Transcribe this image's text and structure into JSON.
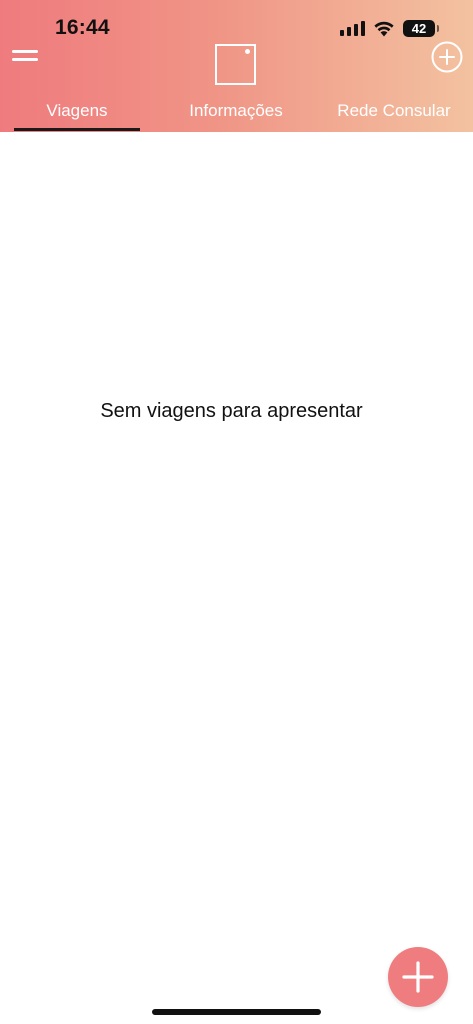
{
  "status_bar": {
    "time": "16:44",
    "battery_level": "42",
    "icons": [
      "signal-icon",
      "wifi-icon",
      "battery-icon"
    ]
  },
  "header": {
    "menu_icon": "menu-icon",
    "logo_icon": "app-logo-icon",
    "add_icon": "add-circle-icon",
    "gradient_start": "#ef7b7e",
    "gradient_end": "#f3c2a0"
  },
  "tabs": [
    {
      "label": "Viagens",
      "active": true
    },
    {
      "label": "Informações",
      "active": false
    },
    {
      "label": "Rede Consular",
      "active": false
    }
  ],
  "main": {
    "empty_message": "Sem viagens para apresentar"
  },
  "fab": {
    "icon": "plus-icon",
    "color": "#ef7d80"
  }
}
